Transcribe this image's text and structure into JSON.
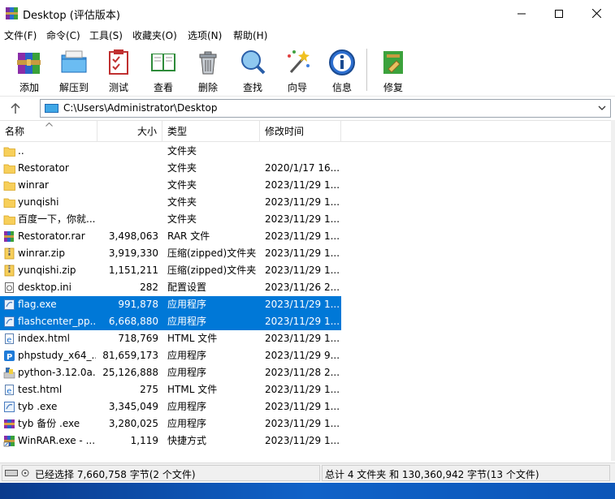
{
  "window": {
    "title": "Desktop (评估版本)"
  },
  "menu": [
    "文件(F)",
    "命令(C)",
    "工具(S)",
    "收藏夹(O)",
    "选项(N)",
    "帮助(H)"
  ],
  "toolbar": [
    {
      "label": "添加",
      "icon": "add-archive-icon"
    },
    {
      "label": "解压到",
      "icon": "extract-to-icon"
    },
    {
      "label": "测试",
      "icon": "test-archive-icon"
    },
    {
      "label": "查看",
      "icon": "view-book-icon"
    },
    {
      "label": "删除",
      "icon": "trash-icon"
    },
    {
      "label": "查找",
      "icon": "magnifier-icon"
    },
    {
      "label": "向导",
      "icon": "wizard-wand-icon"
    },
    {
      "label": "信息",
      "icon": "info-icon"
    },
    {
      "label": "修复",
      "icon": "repair-icon"
    }
  ],
  "address": {
    "path": "C:\\Users\\Administrator\\Desktop"
  },
  "columns": {
    "name": "名称",
    "size": "大小",
    "type": "类型",
    "modified": "修改时间"
  },
  "files": [
    {
      "name": "..",
      "size": "",
      "type": "文件夹",
      "modified": "",
      "icon": "folder-icon"
    },
    {
      "name": "Restorator",
      "size": "",
      "type": "文件夹",
      "modified": "2020/1/17 16...",
      "icon": "folder-icon"
    },
    {
      "name": "winrar",
      "size": "",
      "type": "文件夹",
      "modified": "2023/11/29 1...",
      "icon": "folder-icon"
    },
    {
      "name": "yunqishi",
      "size": "",
      "type": "文件夹",
      "modified": "2023/11/29 1...",
      "icon": "folder-icon"
    },
    {
      "name": "百度一下，你就...",
      "size": "",
      "type": "文件夹",
      "modified": "2023/11/29 1...",
      "icon": "folder-icon"
    },
    {
      "name": "Restorator.rar",
      "size": "3,498,063",
      "type": "RAR 文件",
      "modified": "2023/11/29 1...",
      "icon": "rar-icon"
    },
    {
      "name": "winrar.zip",
      "size": "3,919,330",
      "type": "压缩(zipped)文件夹",
      "modified": "2023/11/29 1...",
      "icon": "zip-icon"
    },
    {
      "name": "yunqishi.zip",
      "size": "1,151,211",
      "type": "压缩(zipped)文件夹",
      "modified": "2023/11/29 1...",
      "icon": "zip-icon"
    },
    {
      "name": "desktop.ini",
      "size": "282",
      "type": "配置设置",
      "modified": "2023/11/26 2...",
      "icon": "ini-file-icon"
    },
    {
      "name": "flag.exe",
      "size": "991,878",
      "type": "应用程序",
      "modified": "2023/11/29 1...",
      "icon": "exe-icon",
      "selected": true
    },
    {
      "name": "flashcenter_pp...",
      "size": "6,668,880",
      "type": "应用程序",
      "modified": "2023/11/29 1...",
      "icon": "exe-icon",
      "selected": true
    },
    {
      "name": "index.html",
      "size": "718,769",
      "type": "HTML 文件",
      "modified": "2023/11/29 1...",
      "icon": "edge-html-icon"
    },
    {
      "name": "phpstudy_x64_...",
      "size": "81,659,173",
      "type": "应用程序",
      "modified": "2023/11/29 9...",
      "icon": "phpstudy-icon"
    },
    {
      "name": "python-3.12.0a...",
      "size": "25,126,888",
      "type": "应用程序",
      "modified": "2023/11/28 2...",
      "icon": "python-installer-icon"
    },
    {
      "name": "test.html",
      "size": "275",
      "type": "HTML 文件",
      "modified": "2023/11/29 1...",
      "icon": "edge-html-icon"
    },
    {
      "name": "tyb .exe",
      "size": "3,345,049",
      "type": "应用程序",
      "modified": "2023/11/29 1...",
      "icon": "exe-icon"
    },
    {
      "name": "tyb 备份 .exe",
      "size": "3,280,025",
      "type": "应用程序",
      "modified": "2023/11/29 1...",
      "icon": "winrar-sfx-icon"
    },
    {
      "name": "WinRAR.exe - ...",
      "size": "1,119",
      "type": "快捷方式",
      "modified": "2023/11/29 1...",
      "icon": "winrar-shortcut-icon"
    }
  ],
  "status": {
    "left": "已经选择 7,660,758 字节(2 个文件)",
    "right": "总计 4 文件夹 和 130,360,942 字节(13 个文件)"
  },
  "colors": {
    "selection": "#0078d7",
    "folder": "#ffd966"
  }
}
